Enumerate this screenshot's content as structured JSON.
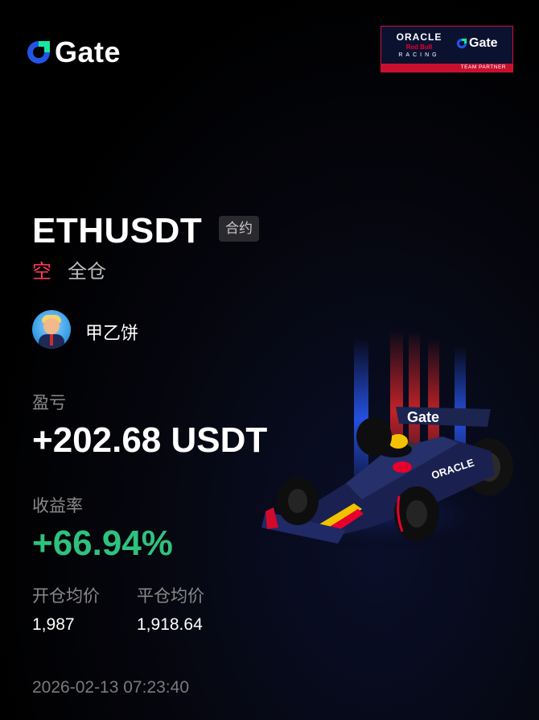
{
  "brand": {
    "name": "Gate",
    "icon": "gate-logo-icon"
  },
  "partner": {
    "line1": "ORACLE",
    "line2": "Red Bull",
    "line3": "RACING",
    "brand_name": "Gate",
    "tagline": "TEAM PARTNER"
  },
  "position": {
    "pair": "ETHUSDT",
    "contract_tag": "合约",
    "side": "空",
    "margin_mode": "全仓"
  },
  "user": {
    "name": "甲乙饼",
    "avatar": "user-avatar"
  },
  "pnl": {
    "label": "盈亏",
    "value": "+202.68 USDT"
  },
  "roi": {
    "label": "收益率",
    "value": "+66.94%"
  },
  "prices": {
    "open_label": "开仓均价",
    "open_value": "1,987",
    "close_label": "平仓均价",
    "close_value": "1,918.64"
  },
  "timestamp": "2026-02-13 07:23:40",
  "colors": {
    "background": "#000000",
    "short_red": "#ff3a5c",
    "profit_green": "#2ec27e",
    "label_gray": "#8a8a8a",
    "brand_blue": "#2354e6",
    "partner_red": "#c8102e"
  }
}
